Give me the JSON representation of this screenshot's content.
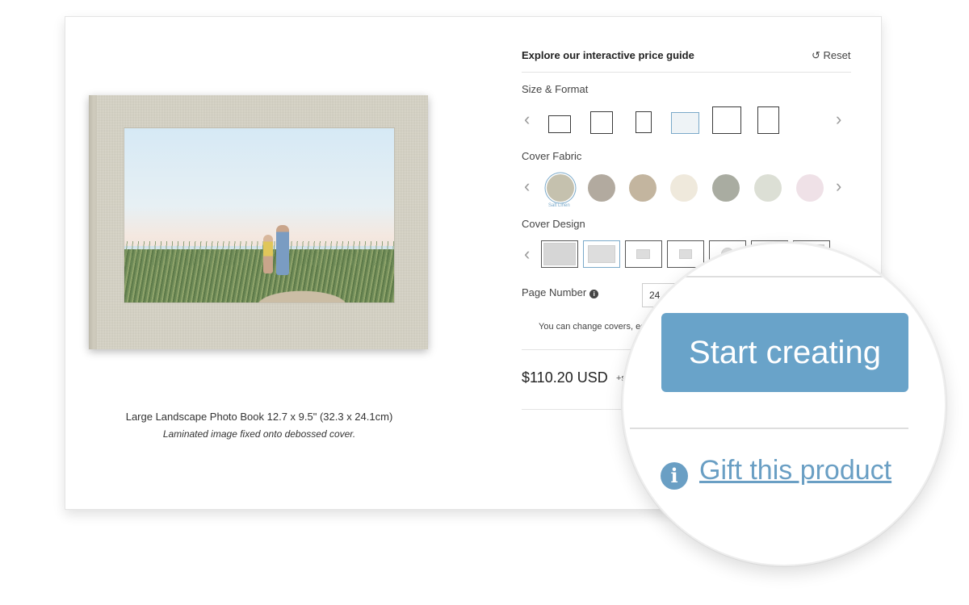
{
  "configurator": {
    "title": "Explore our interactive price guide",
    "reset_label": "↺ Reset",
    "size_format_label": "Size & Format",
    "cover_fabric_label": "Cover Fabric",
    "cover_design_label": "Cover Design",
    "page_number_label": "Page Number",
    "page_number_value": "24",
    "note": "You can change covers, edi",
    "price": "$110.20 USD",
    "price_extra": "+sh",
    "selected_fabric_name": "Salt Linen",
    "arrow_left": "‹",
    "arrow_right": "›",
    "info_glyph": "i"
  },
  "fabric_colors": [
    "#c5c1ae",
    "#b2aa9f",
    "#c3b59f",
    "#efe9dc",
    "#a9aca1",
    "#dcdfd5",
    "#efe1e7"
  ],
  "product": {
    "name": "Large Landscape Photo Book 12.7 x 9.5\" (32.3 x 24.1cm)",
    "description": "Laminated image fixed onto debossed cover."
  },
  "magnifier": {
    "cta_label": "Start creating",
    "gift_label": "Gift this product",
    "info_glyph": "i"
  },
  "colors": {
    "accent": "#69a3c9",
    "link": "#6a9fc4",
    "selected_outline": "#7aa9c9"
  }
}
